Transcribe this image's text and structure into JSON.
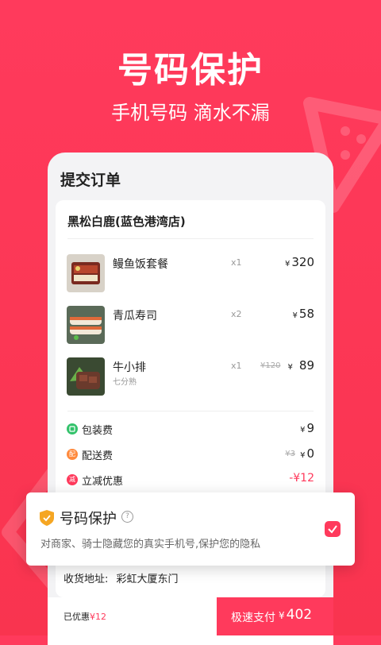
{
  "hero": {
    "title": "号码保护",
    "subtitle": "手机号码 滴水不漏"
  },
  "screen": {
    "title": "提交订单"
  },
  "order": {
    "store": "黑松白鹿(蓝色港湾店)",
    "items": [
      {
        "name": "鳗鱼饭套餐",
        "spec": "",
        "qty": "x1",
        "price": "320",
        "orig": ""
      },
      {
        "name": "青瓜寿司",
        "spec": "",
        "qty": "x2",
        "price": "58",
        "orig": ""
      },
      {
        "name": "牛小排",
        "spec": "七分熟",
        "qty": "x1",
        "price": "89",
        "orig": "¥120"
      }
    ],
    "fees": [
      {
        "icon_text": "",
        "label": "包装费",
        "value": "9",
        "orig": "",
        "color": "#33c26b"
      },
      {
        "icon_text": "配",
        "label": "配送费",
        "value": "0",
        "orig": "¥3",
        "color": "#ff8a3d"
      },
      {
        "icon_text": "减",
        "label": "立减优惠",
        "value": "-¥12",
        "orig": "",
        "color": "#ff3a5c"
      }
    ]
  },
  "address": {
    "label": "收货地址:",
    "value": "彩虹大厦东门"
  },
  "bottom": {
    "saved_label": "已优惠",
    "saved_amount": "¥12",
    "pay_label": "极速支付",
    "pay_amount": "402"
  },
  "popup": {
    "title": "号码保护",
    "help": "?",
    "desc": "对商家、骑士隐藏您的真实手机号,保护您的隐私",
    "checked": true
  },
  "currency_symbol": "¥",
  "icons": {
    "shield": "shield-icon",
    "check": "check-icon",
    "help": "help-icon",
    "slice": "watermelon-slice-icon"
  },
  "colors": {
    "brand": "#ff3a5c",
    "shield": "#f5a623",
    "bg": "#f3f3f5"
  }
}
